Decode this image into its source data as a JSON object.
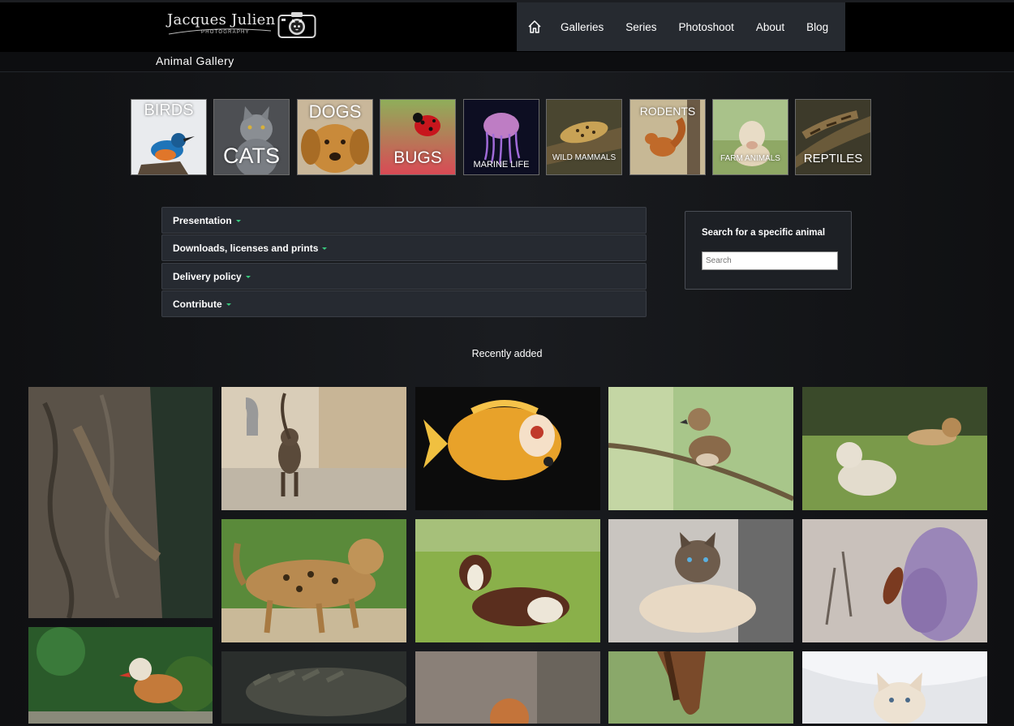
{
  "brand": {
    "name": "Jacques Julien",
    "tagline": "PHOTOGRAPHY"
  },
  "nav": {
    "items": [
      {
        "label": "Galleries"
      },
      {
        "label": "Series"
      },
      {
        "label": "Photoshoot"
      },
      {
        "label": "About"
      },
      {
        "label": "Blog"
      }
    ]
  },
  "page": {
    "title": "Animal Gallery"
  },
  "categories": [
    {
      "label": "BIRDS"
    },
    {
      "label": "CATS"
    },
    {
      "label": "DOGS"
    },
    {
      "label": "BUGS"
    },
    {
      "label": "MARINE LIFE"
    },
    {
      "label": "WILD MAMMALS"
    },
    {
      "label": "RODENTS"
    },
    {
      "label": "FARM ANIMALS"
    },
    {
      "label": "REPTILES"
    }
  ],
  "accordion": [
    {
      "label": "Presentation"
    },
    {
      "label": "Downloads, licenses and prints"
    },
    {
      "label": "Delivery policy"
    },
    {
      "label": "Contribute"
    }
  ],
  "search": {
    "title": "Search for a specific animal",
    "placeholder": "Search"
  },
  "recent": {
    "title": "Recently added"
  },
  "colors": {
    "accent_caret": "#38c97e",
    "nav_bg": "#262a30",
    "header_bg": "#000000"
  }
}
